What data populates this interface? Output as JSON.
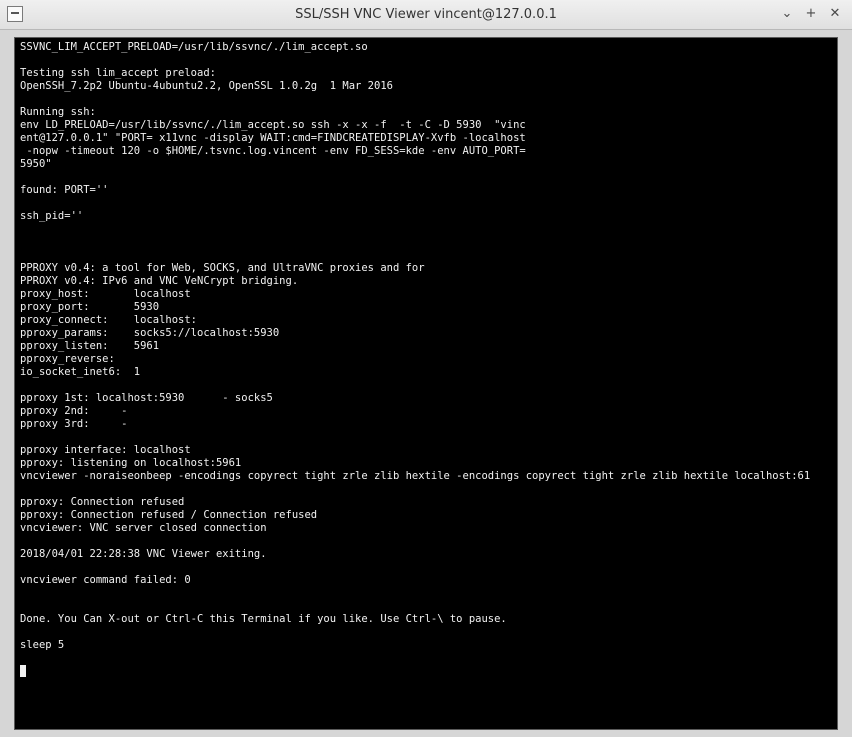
{
  "window": {
    "title": "SSL/SSH VNC Viewer vincent@127.0.0.1",
    "minimize_glyph": "⌄",
    "maximize_glyph": "+",
    "close_glyph": "✕"
  },
  "terminal": {
    "lines": [
      "SSVNC_LIM_ACCEPT_PRELOAD=/usr/lib/ssvnc/./lim_accept.so",
      "",
      "Testing ssh lim_accept preload:",
      "OpenSSH_7.2p2 Ubuntu-4ubuntu2.2, OpenSSL 1.0.2g  1 Mar 2016",
      "",
      "Running ssh:",
      "env LD_PRELOAD=/usr/lib/ssvnc/./lim_accept.so ssh -x -x -f  -t -C -D 5930  \"vinc",
      "ent@127.0.0.1\" \"PORT= x11vnc -display WAIT:cmd=FINDCREATEDISPLAY-Xvfb -localhost",
      " -nopw -timeout 120 -o $HOME/.tsvnc.log.vincent -env FD_SESS=kde -env AUTO_PORT=",
      "5950\"",
      "",
      "found: PORT=''",
      "",
      "ssh_pid=''",
      "",
      "",
      "",
      "PPROXY v0.4: a tool for Web, SOCKS, and UltraVNC proxies and for",
      "PPROXY v0.4: IPv6 and VNC VeNCrypt bridging.",
      "proxy_host:       localhost",
      "proxy_port:       5930",
      "proxy_connect:    localhost:",
      "pproxy_params:    socks5://localhost:5930",
      "pproxy_listen:    5961",
      "pproxy_reverse:",
      "io_socket_inet6:  1",
      "",
      "pproxy 1st: localhost:5930      - socks5",
      "pproxy 2nd:     -",
      "pproxy 3rd:     -",
      "",
      "pproxy interface: localhost",
      "pproxy: listening on localhost:5961",
      "vncviewer -noraiseonbeep -encodings copyrect tight zrle zlib hextile -encodings copyrect tight zrle zlib hextile localhost:61",
      "",
      "pproxy: Connection refused",
      "pproxy: Connection refused / Connection refused",
      "vncviewer: VNC server closed connection",
      "",
      "2018/04/01 22:28:38 VNC Viewer exiting.",
      "",
      "vncviewer command failed: 0",
      "",
      "",
      "Done. You Can X-out or Ctrl-C this Terminal if you like. Use Ctrl-\\ to pause.",
      "",
      "sleep 5",
      ""
    ]
  }
}
